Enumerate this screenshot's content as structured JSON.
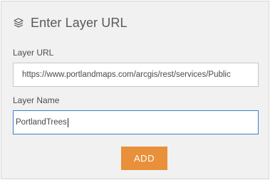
{
  "dialog": {
    "title": "Enter Layer URL",
    "icon": "layers-icon"
  },
  "layer_url": {
    "label": "Layer URL",
    "value": "https://www.portlandmaps.com/arcgis/rest/services/Public"
  },
  "layer_name": {
    "label": "Layer Name",
    "value": "PortlandTrees"
  },
  "actions": {
    "add_label": "ADD"
  },
  "colors": {
    "panel_bg": "#f1f1f1",
    "add_button_bg": "#e8903a",
    "focus_border": "#3a7fc4"
  }
}
